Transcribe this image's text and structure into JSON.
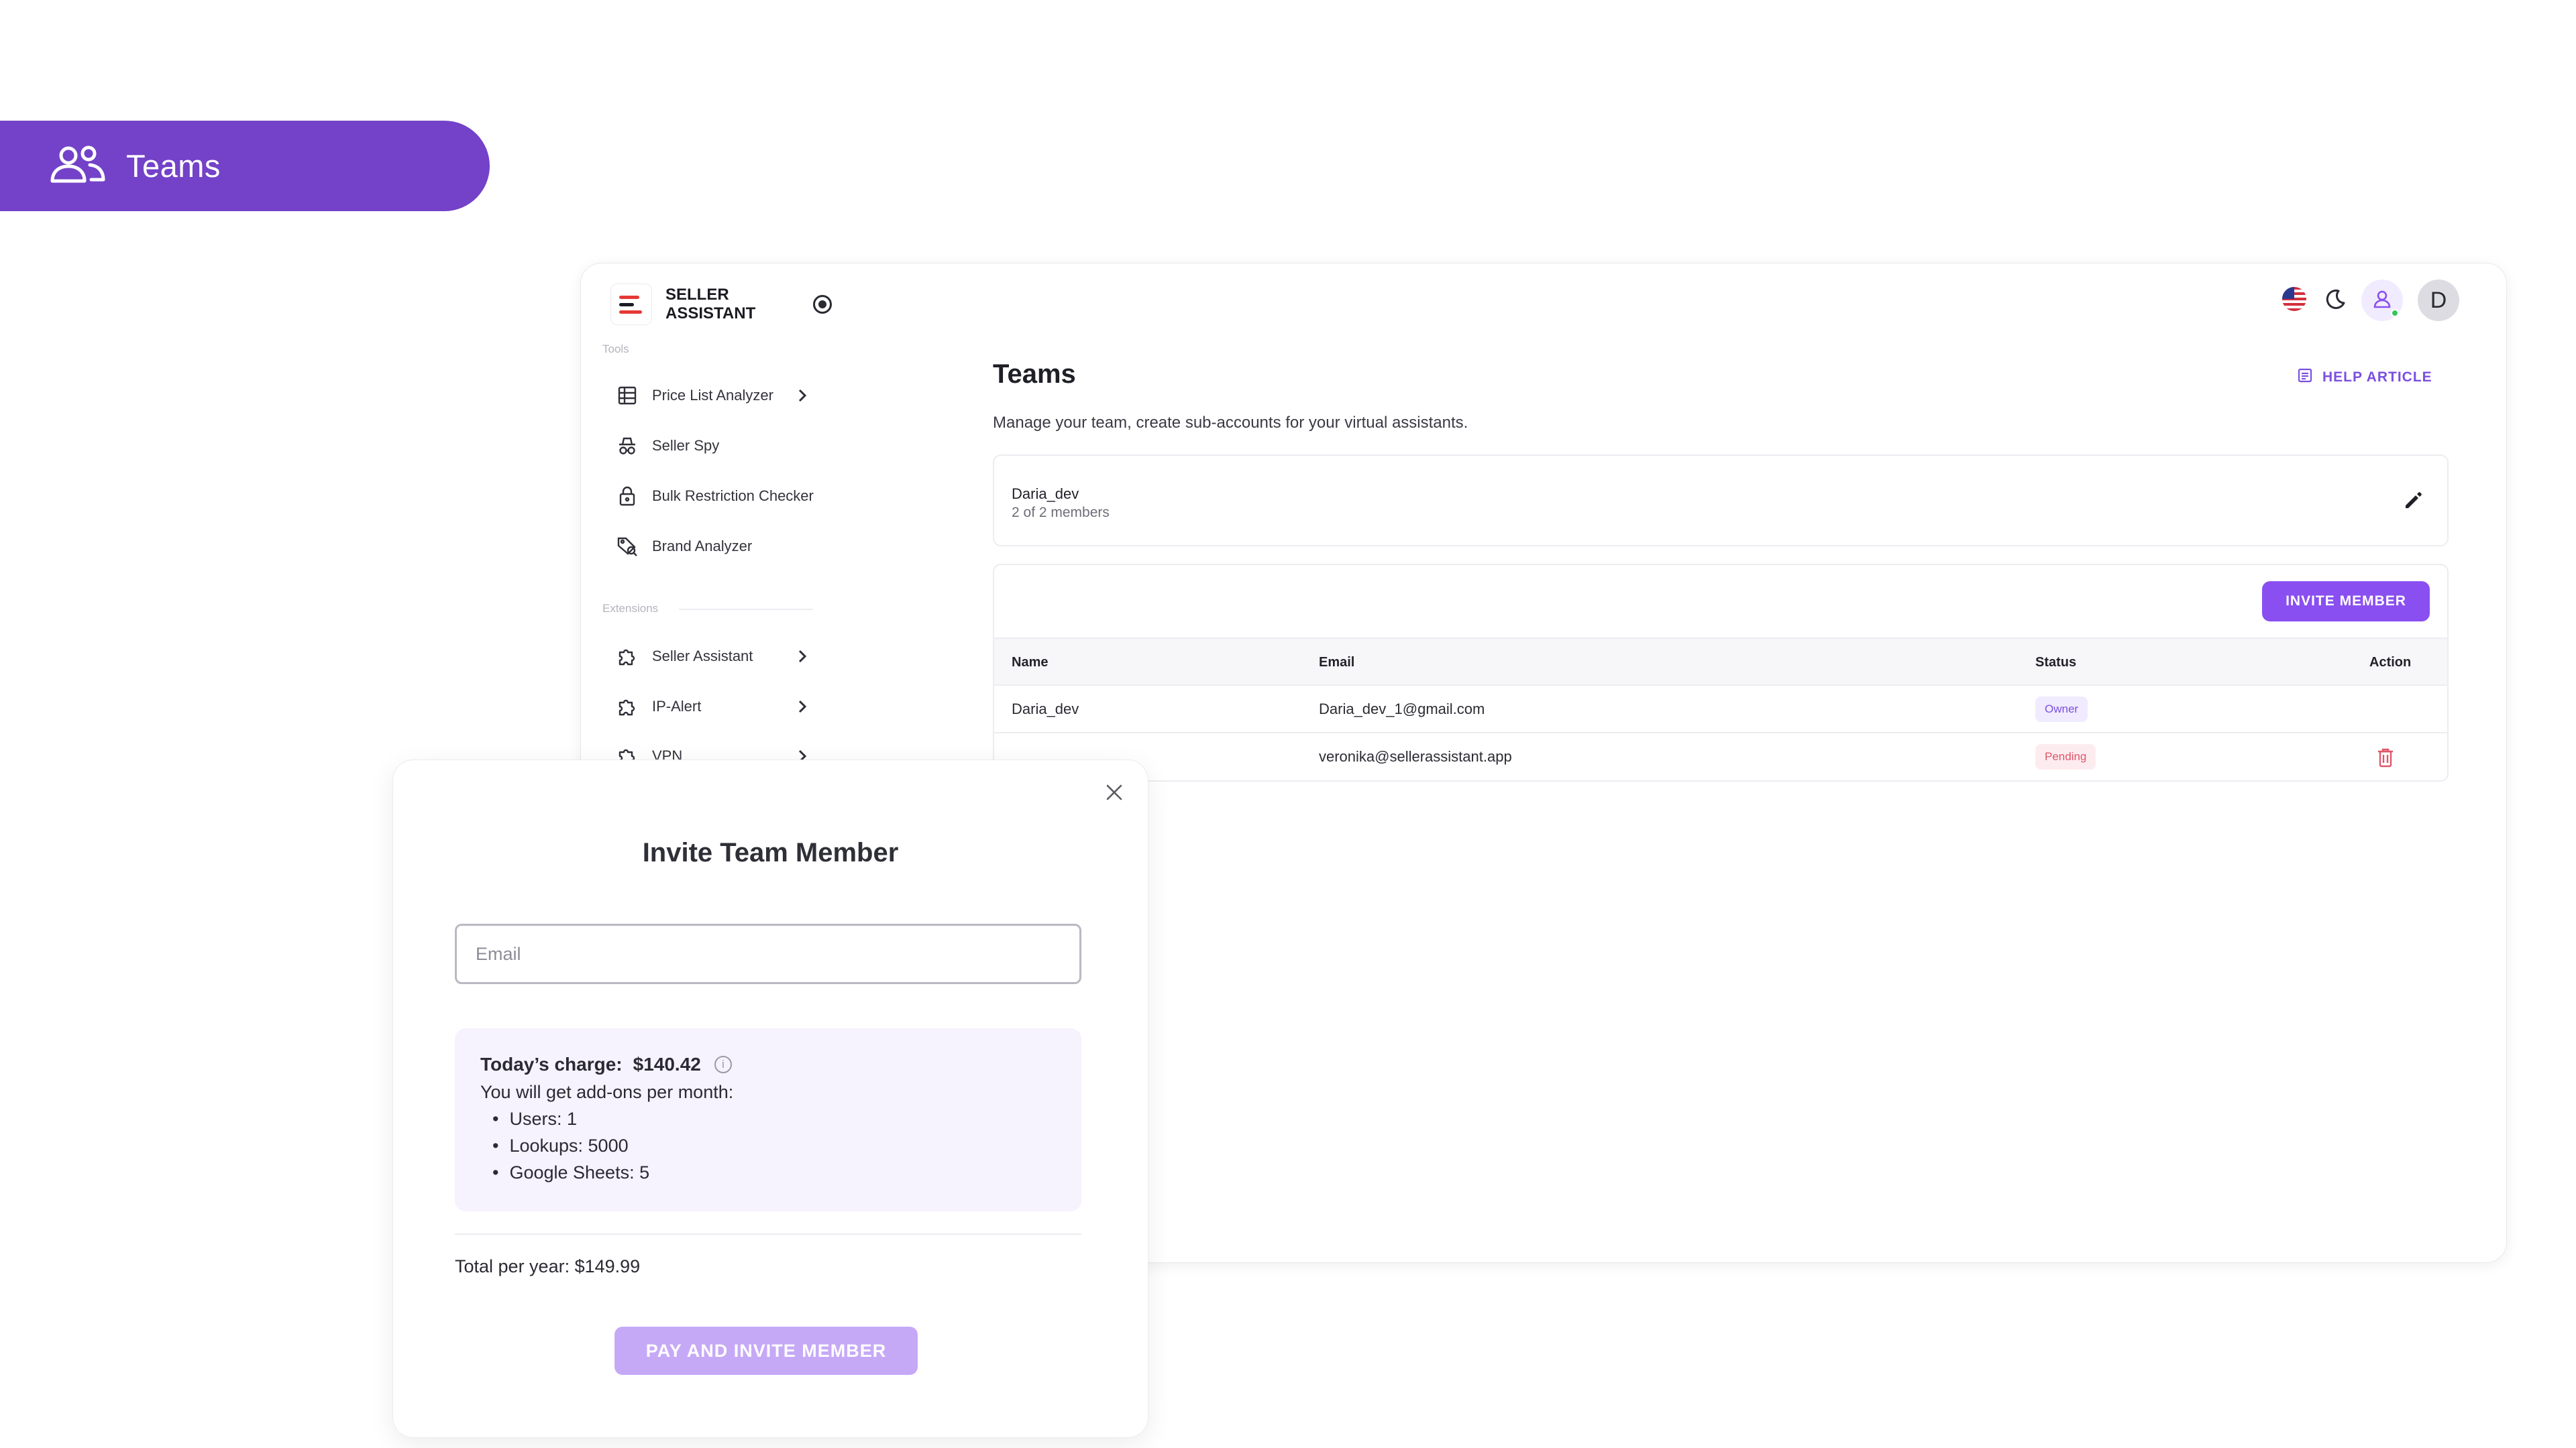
{
  "badge": {
    "label": "Teams",
    "icon": "users-icon",
    "color": "#7342c8"
  },
  "app": {
    "brand_line1": "SELLER",
    "brand_line2": "ASSISTANT",
    "sidebar": {
      "tools_label": "Tools",
      "tools": [
        {
          "label": "Price List Analyzer",
          "icon": "table-icon",
          "has_chevron": true
        },
        {
          "label": "Seller Spy",
          "icon": "spy-icon",
          "has_chevron": false
        },
        {
          "label": "Bulk Restriction Checker",
          "icon": "lock-icon",
          "has_chevron": false
        },
        {
          "label": "Brand Analyzer",
          "icon": "tag-search-icon",
          "has_chevron": false
        }
      ],
      "extensions_label": "Extensions",
      "extensions": [
        {
          "label": "Seller Assistant",
          "icon": "puzzle-icon",
          "has_chevron": true
        },
        {
          "label": "IP-Alert",
          "icon": "puzzle-icon",
          "has_chevron": true
        },
        {
          "label": "VPN",
          "icon": "puzzle-icon",
          "has_chevron": true
        }
      ]
    },
    "header": {
      "avatar_initial": "D",
      "icons": [
        "us-flag-icon",
        "moon-icon",
        "user-icon"
      ]
    },
    "page": {
      "title": "Teams",
      "help_label": "HELP ARTICLE",
      "description": "Manage your team, create sub-accounts for your virtual assistants.",
      "team": {
        "name": "Daria_dev",
        "members_count": "2 of 2 members"
      },
      "invite_label": "INVITE MEMBER",
      "table": {
        "headers": {
          "name": "Name",
          "email": "Email",
          "status": "Status",
          "action": "Action"
        },
        "rows": [
          {
            "name": "Daria_dev",
            "email": "Daria_dev_1@gmail.com",
            "status": "Owner"
          },
          {
            "name": "",
            "email": "veronika@sellerassistant.app",
            "status": "Pending"
          }
        ]
      }
    }
  },
  "modal": {
    "title": "Invite Team Member",
    "email_placeholder": "Email",
    "email_value": "",
    "charge_label": "Today’s charge:",
    "charge_amount": "$140.42",
    "addons_intro": "You will get add-ons per month:",
    "addons": [
      "Users: 1",
      "Lookups: 5000",
      "Google Sheets: 5"
    ],
    "total": "Total per year: $149.99",
    "pay_label": "PAY AND INVITE MEMBER"
  },
  "colors": {
    "accent": "#8a4ff0",
    "owner_badge_text": "#7a4fe0",
    "pending_badge_text": "#e0566a",
    "pay_button": "#c6a9f6"
  }
}
